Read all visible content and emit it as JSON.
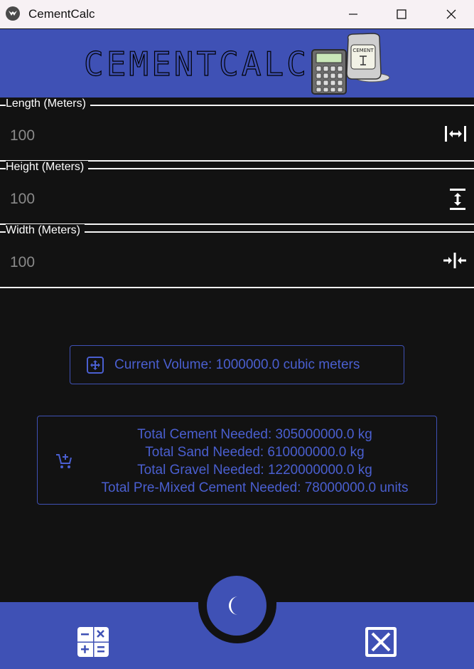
{
  "window": {
    "title": "CementCalc",
    "app_icon": "kivy-icon",
    "controls": [
      "minimize-icon",
      "maximize-icon",
      "close-icon"
    ]
  },
  "banner": {
    "logo_text": "CEMENTCALC",
    "bag_label": "CEMENT",
    "accent_color": "#3f51b5"
  },
  "fields": [
    {
      "label": "Length (Meters)",
      "value": "100",
      "icon": "arrow-expand-horizontal-icon"
    },
    {
      "label": "Height (Meters)",
      "value": "100",
      "icon": "arrow-expand-vertical-icon"
    },
    {
      "label": "Width (Meters)",
      "value": "100",
      "icon": "arrow-collapse-horizontal-icon"
    }
  ],
  "volume": {
    "icon": "move-arrows-icon",
    "text": "Current Volume: 1000000.0 cubic meters"
  },
  "totals": {
    "icon": "cart-plus-icon",
    "lines": [
      "Total Cement Needed: 305000000.0 kg",
      "Total Sand Needed: 610000000.0 kg",
      "Total Gravel Needed: 1220000000.0 kg",
      "Total Pre-Mixed Cement Needed: 78000000.0 units"
    ]
  },
  "bottom_bar": {
    "left_icon": "calculator-variant-icon",
    "center_icon": "moon-icon",
    "right_icon": "close-box-icon"
  }
}
